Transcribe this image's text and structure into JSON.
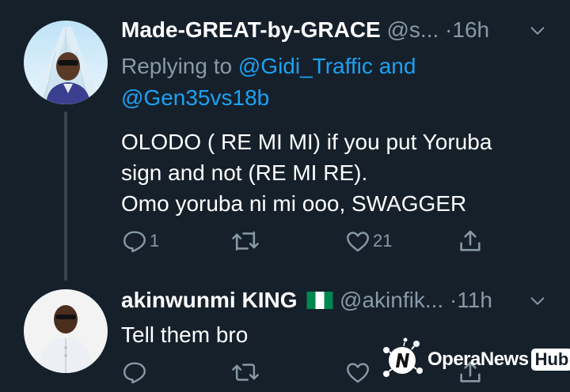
{
  "tweets": [
    {
      "name": "Made-GREAT-by-GRACE",
      "handle": "@s...",
      "dot": "·",
      "time": "16h",
      "replying_prefix": "Replying to",
      "replying_user1": "@Gidi_Traffic",
      "replying_and": "and",
      "replying_user2": "@Gen35vs18b",
      "text_lines": [
        "OLODO ( RE MI MI) if you put Yoruba",
        "sign and not (RE MI RE).",
        "Omo yoruba ni mi ooo, SWAGGER"
      ],
      "reply_count": "1",
      "like_count": "21"
    },
    {
      "name": "akinwunmi KING",
      "handle": "@akinfik...",
      "dot": "·",
      "time": "11h",
      "text": "Tell them bro"
    }
  ],
  "watermark": {
    "brand": "OperaNews",
    "hub": "Hub"
  },
  "colors": {
    "background": "#15202b",
    "secondary_text": "#8899a6",
    "link": "#1da1f2",
    "divider": "#38444d"
  },
  "icons": [
    "chevron-down-icon",
    "reply-icon",
    "retweet-icon",
    "like-icon",
    "share-icon",
    "nigeria-flag-icon"
  ]
}
